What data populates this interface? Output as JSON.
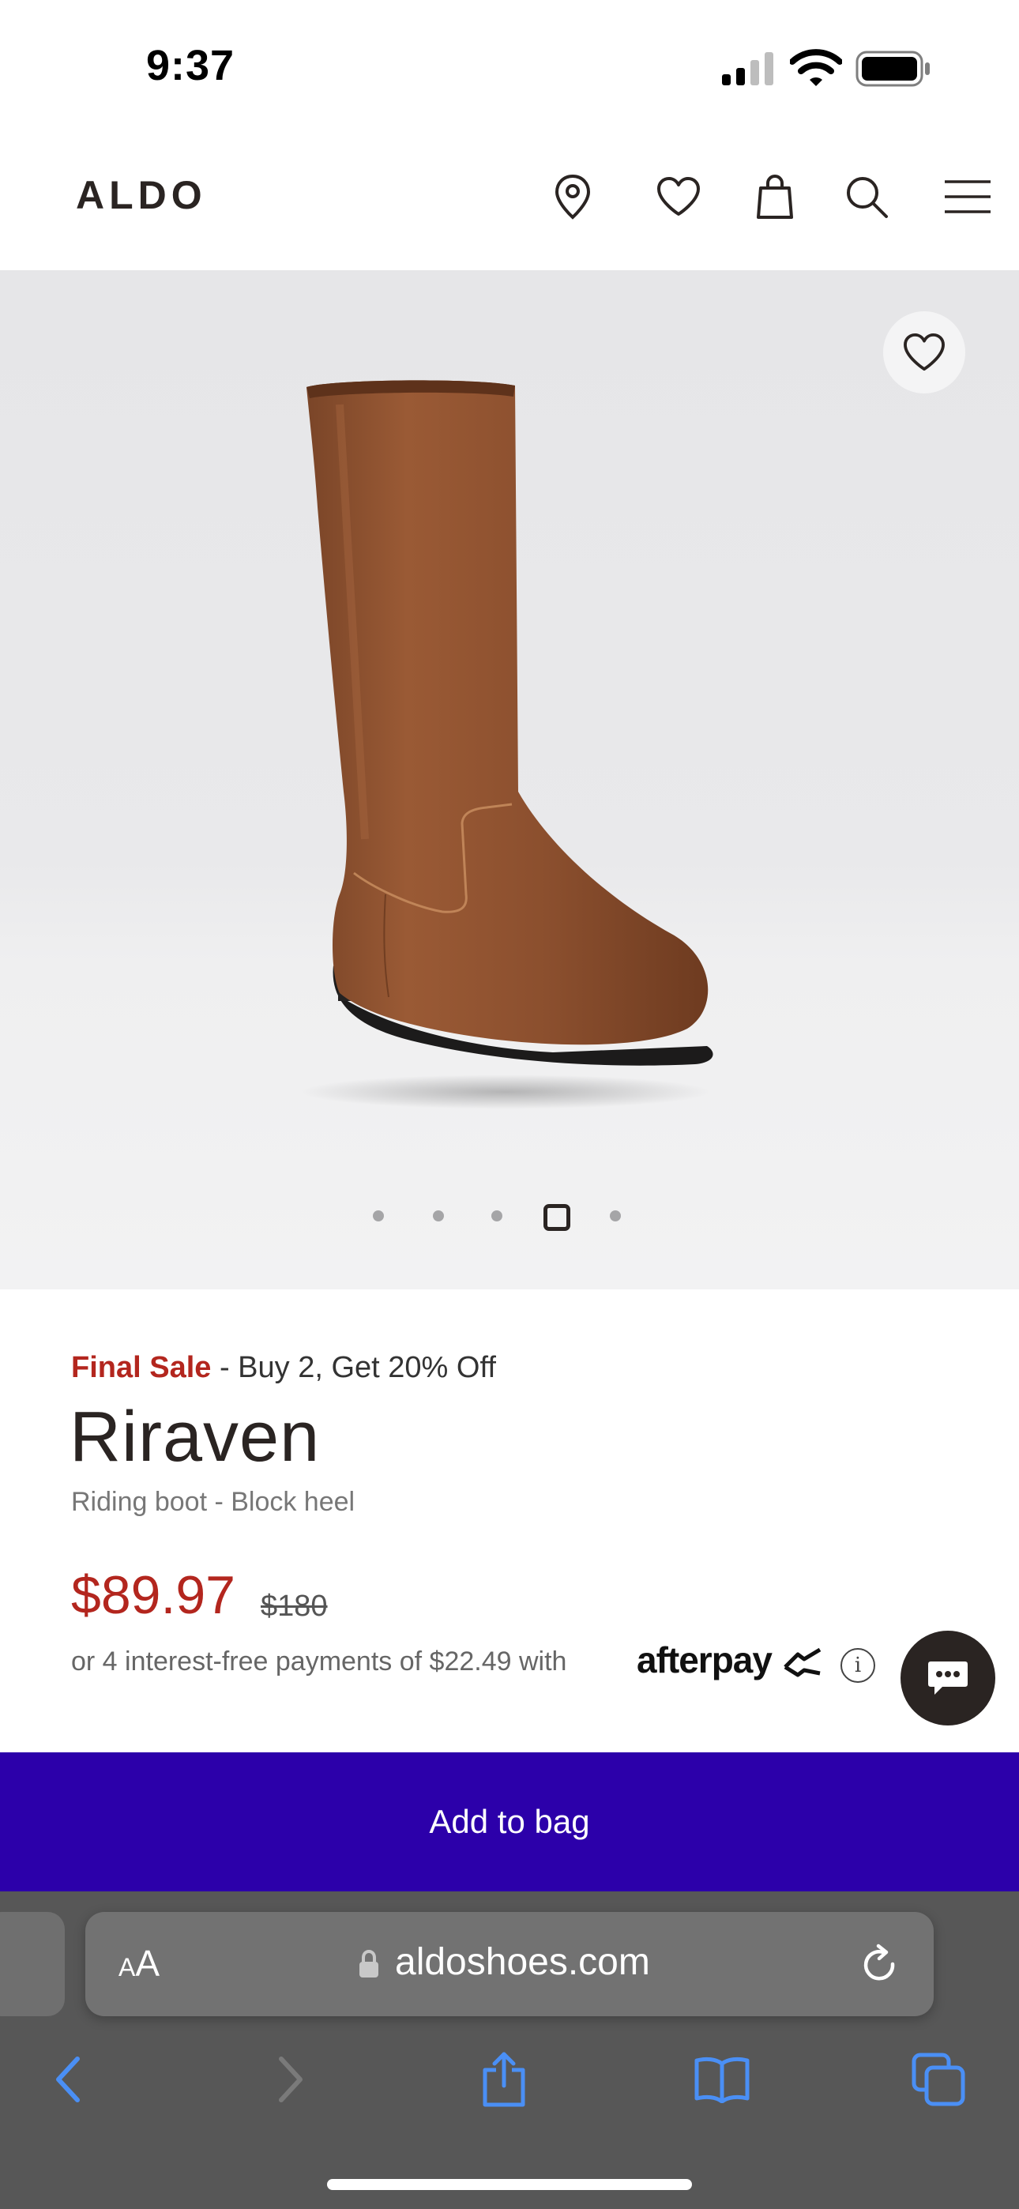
{
  "status_bar": {
    "time": "9:37"
  },
  "header": {
    "logo": "ALDO",
    "icons": [
      "location-pin-icon",
      "heart-icon",
      "shopping-bag-icon",
      "search-icon",
      "menu-icon"
    ]
  },
  "gallery": {
    "image_count": 5,
    "active_index": 3
  },
  "product": {
    "final_sale": "Final Sale",
    "promo": "- Buy 2, Get 20% Off",
    "name": "Riraven",
    "subtitle": "Riding boot - Block heel",
    "sale_price": "$89.97",
    "original_price": "$180",
    "installments": "or 4 interest-free payments of $22.49 with",
    "afterpay": "afterpay",
    "info_glyph": "i"
  },
  "cta": {
    "add_to_bag": "Add to bag"
  },
  "browser": {
    "aa_small": "A",
    "aa_large": "A",
    "url": "aldoshoes.com"
  },
  "colors": {
    "accent_sale": "#b3261e",
    "cta_purple": "#2c00aa",
    "brand_dark": "#2a2422",
    "safari_bar": "#575757",
    "safari_blue": "#4a8ff5"
  }
}
